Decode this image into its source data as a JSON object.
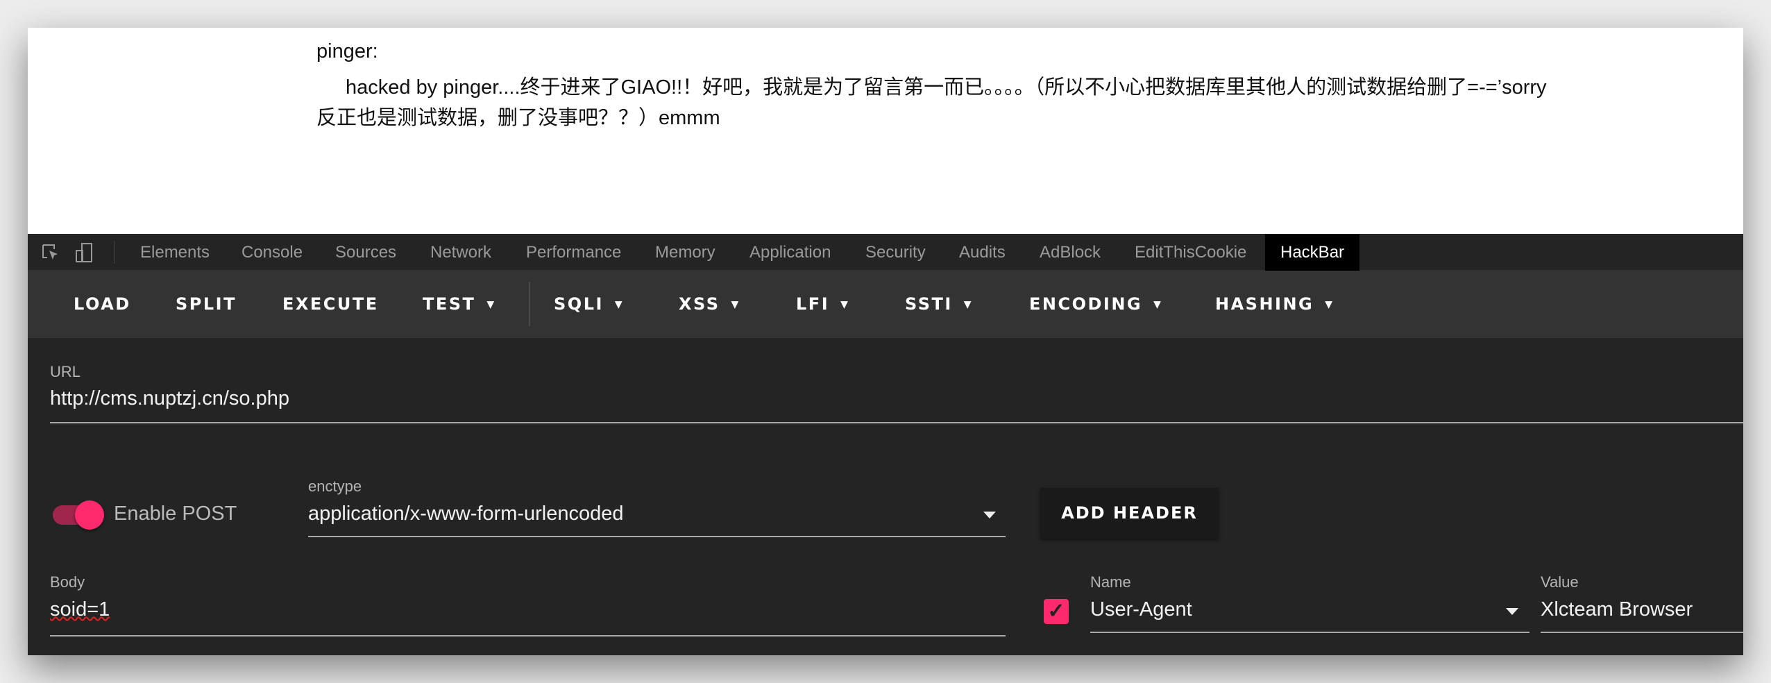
{
  "page": {
    "author": "pinger:",
    "line1": "hacked by pinger....终于进来了GIAO!!！好吧，我就是为了留言第一而已。。。。（所以不小心把数据库里其他人的测试数据给删了=-=’sorry",
    "line2": "反正也是测试数据，删了没事吧？？）emmm"
  },
  "devtools": {
    "tabs": [
      "Elements",
      "Console",
      "Sources",
      "Network",
      "Performance",
      "Memory",
      "Application",
      "Security",
      "Audits",
      "AdBlock",
      "EditThisCookie",
      "HackBar"
    ],
    "active_tab": "HackBar"
  },
  "toolbar": {
    "load": "LOAD",
    "split": "SPLIT",
    "execute": "EXECUTE",
    "test": "TEST",
    "sqli": "SQLI",
    "xss": "XSS",
    "lfi": "LFI",
    "ssti": "SSTI",
    "encoding": "ENCODING",
    "hashing": "HASHING"
  },
  "form": {
    "url_label": "URL",
    "url_value": "http://cms.nuptzj.cn/so.php",
    "enable_post_label": "Enable POST",
    "enable_post": true,
    "enctype_label": "enctype",
    "enctype_value": "application/x-www-form-urlencoded",
    "add_header": "ADD HEADER",
    "body_label": "Body",
    "body_value": "soid=1",
    "header_enabled": true,
    "name_label": "Name",
    "name_value": "User-Agent",
    "value_label": "Value",
    "value_value": "Xlcteam Browser"
  },
  "colors": {
    "accent": "#ff2a6d"
  }
}
